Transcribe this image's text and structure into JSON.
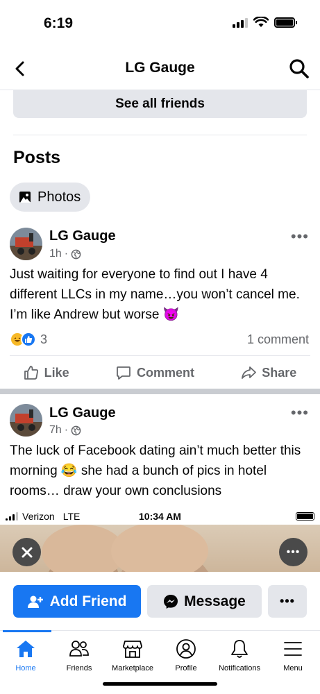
{
  "status_bar": {
    "time": "6:19"
  },
  "nav": {
    "title": "LG Gauge"
  },
  "friends": {
    "see_all_label": "See all friends"
  },
  "posts_section": {
    "heading": "Posts",
    "photos_chip": "Photos"
  },
  "posts": [
    {
      "author": "LG Gauge",
      "time": "1h",
      "separator": "·",
      "text": "Just waiting for everyone to find out I have 4 different LLCs in my name…you won’t cancel me. I’m like Andrew but worse 😈",
      "reaction_count": "3",
      "comment_count": "1 comment",
      "actions": {
        "like": "Like",
        "comment": "Comment",
        "share": "Share"
      }
    },
    {
      "author": "LG Gauge",
      "time": "7h",
      "separator": "·",
      "text": "The luck of Facebook dating ain’t much better this morning 😂 she had a bunch of pics in hotel rooms… draw your own conclusions",
      "embedded_screenshot": {
        "carrier": "Verizon",
        "network": "LTE",
        "time": "10:34 AM"
      }
    }
  ],
  "profile_actions": {
    "add_friend": "Add Friend",
    "message": "Message",
    "more": "•••"
  },
  "tabs": [
    {
      "label": "Home",
      "icon": "home-icon",
      "active": true
    },
    {
      "label": "Friends",
      "icon": "friends-icon"
    },
    {
      "label": "Marketplace",
      "icon": "marketplace-icon"
    },
    {
      "label": "Profile",
      "icon": "profile-icon"
    },
    {
      "label": "Notifications",
      "icon": "bell-icon"
    },
    {
      "label": "Menu",
      "icon": "menu-icon"
    }
  ],
  "colors": {
    "accent": "#1877f2",
    "secondary_bg": "#e4e6eb",
    "muted_text": "#65676b"
  }
}
